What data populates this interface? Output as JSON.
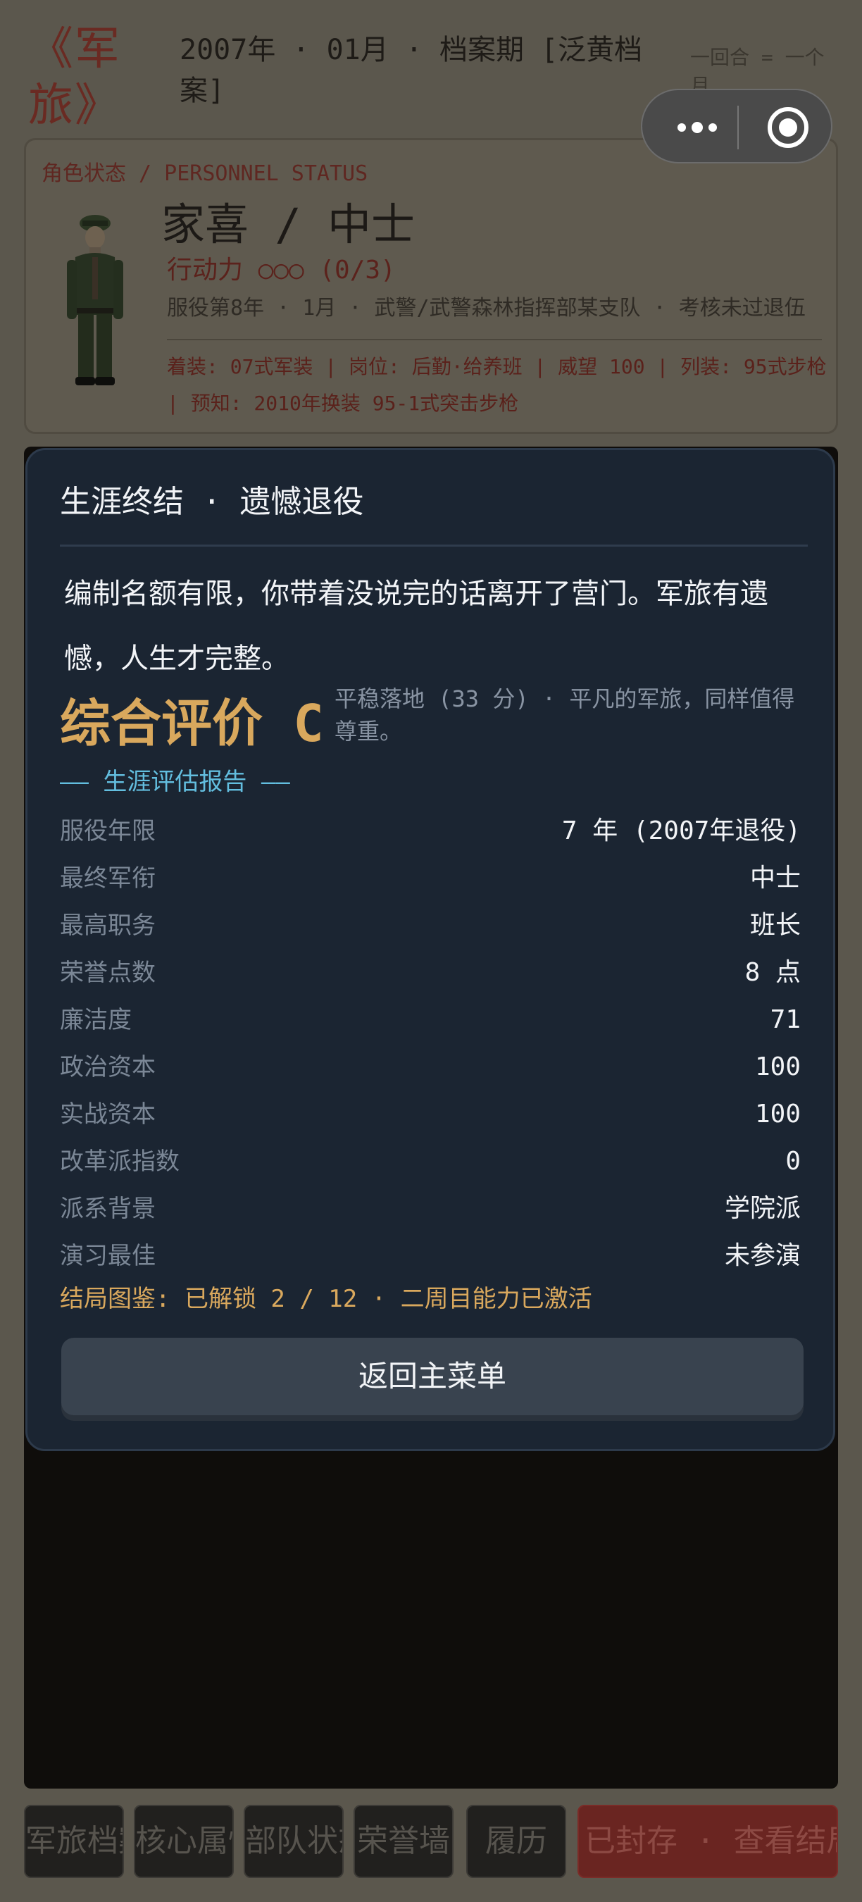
{
  "header": {
    "brand": "《军旅》",
    "date_line": "2007年 · 01月 · 档案期 [泛黄档案]",
    "turn_note": "一回合 = 一个月"
  },
  "miniprogram_capsule": {
    "menu_icon": "more-dots-icon",
    "close_icon": "record-target-icon"
  },
  "status": {
    "title": "角色状态 / PERSONNEL STATUS",
    "name_rank": "家喜 / 中士",
    "action_points": "行动力 ○○○ (0/3)",
    "service_line": "服役第8年 · 1月 · 武警/武警森林指挥部某支队 · 考核未过退伍",
    "details": "着装: 07式军装 | 岗位: 后勤·给养班 | 威望 100 | 列装: 95式步枪 | 预知: 2010年换装 95-1式突击步枪"
  },
  "modal": {
    "title": "生涯终结 · 遗憾退役",
    "body": "编制名额有限，你带着没说完的话离开了营门。军旅有遗憾，人生才完整。",
    "grade": "综合评价 C",
    "grade_desc": "平稳落地 (33 分) · 平凡的军旅，同样值得尊重。",
    "report_heading": "—— 生涯评估报告 ——",
    "rows": [
      {
        "label": "服役年限",
        "value": "7 年 (2007年退役)"
      },
      {
        "label": "最终军衔",
        "value": "中士"
      },
      {
        "label": "最高职务",
        "value": "班长"
      },
      {
        "label": "荣誉点数",
        "value": "8 点"
      },
      {
        "label": "廉洁度",
        "value": "71"
      },
      {
        "label": "政治资本",
        "value": "100"
      },
      {
        "label": "实战资本",
        "value": "100"
      },
      {
        "label": "改革派指数",
        "value": "0"
      },
      {
        "label": "派系背景",
        "value": "学院派"
      },
      {
        "label": "演习最佳",
        "value": "未参演"
      }
    ],
    "unlock_line": "结局图鉴: 已解锁 2 / 12 · 二周目能力已激活",
    "return_button": "返回主菜单"
  },
  "nav": {
    "tabs": [
      "军旅档案",
      "核心属性",
      "部队状态",
      "荣誉墙",
      "履历"
    ],
    "sealed": "已封存 · 查看结局"
  },
  "colors": {
    "modal_bg": "#1b2532",
    "grade_gold": "#d9a85d",
    "report_cyan": "#63bedf",
    "sealed_red": "#6a2521"
  }
}
